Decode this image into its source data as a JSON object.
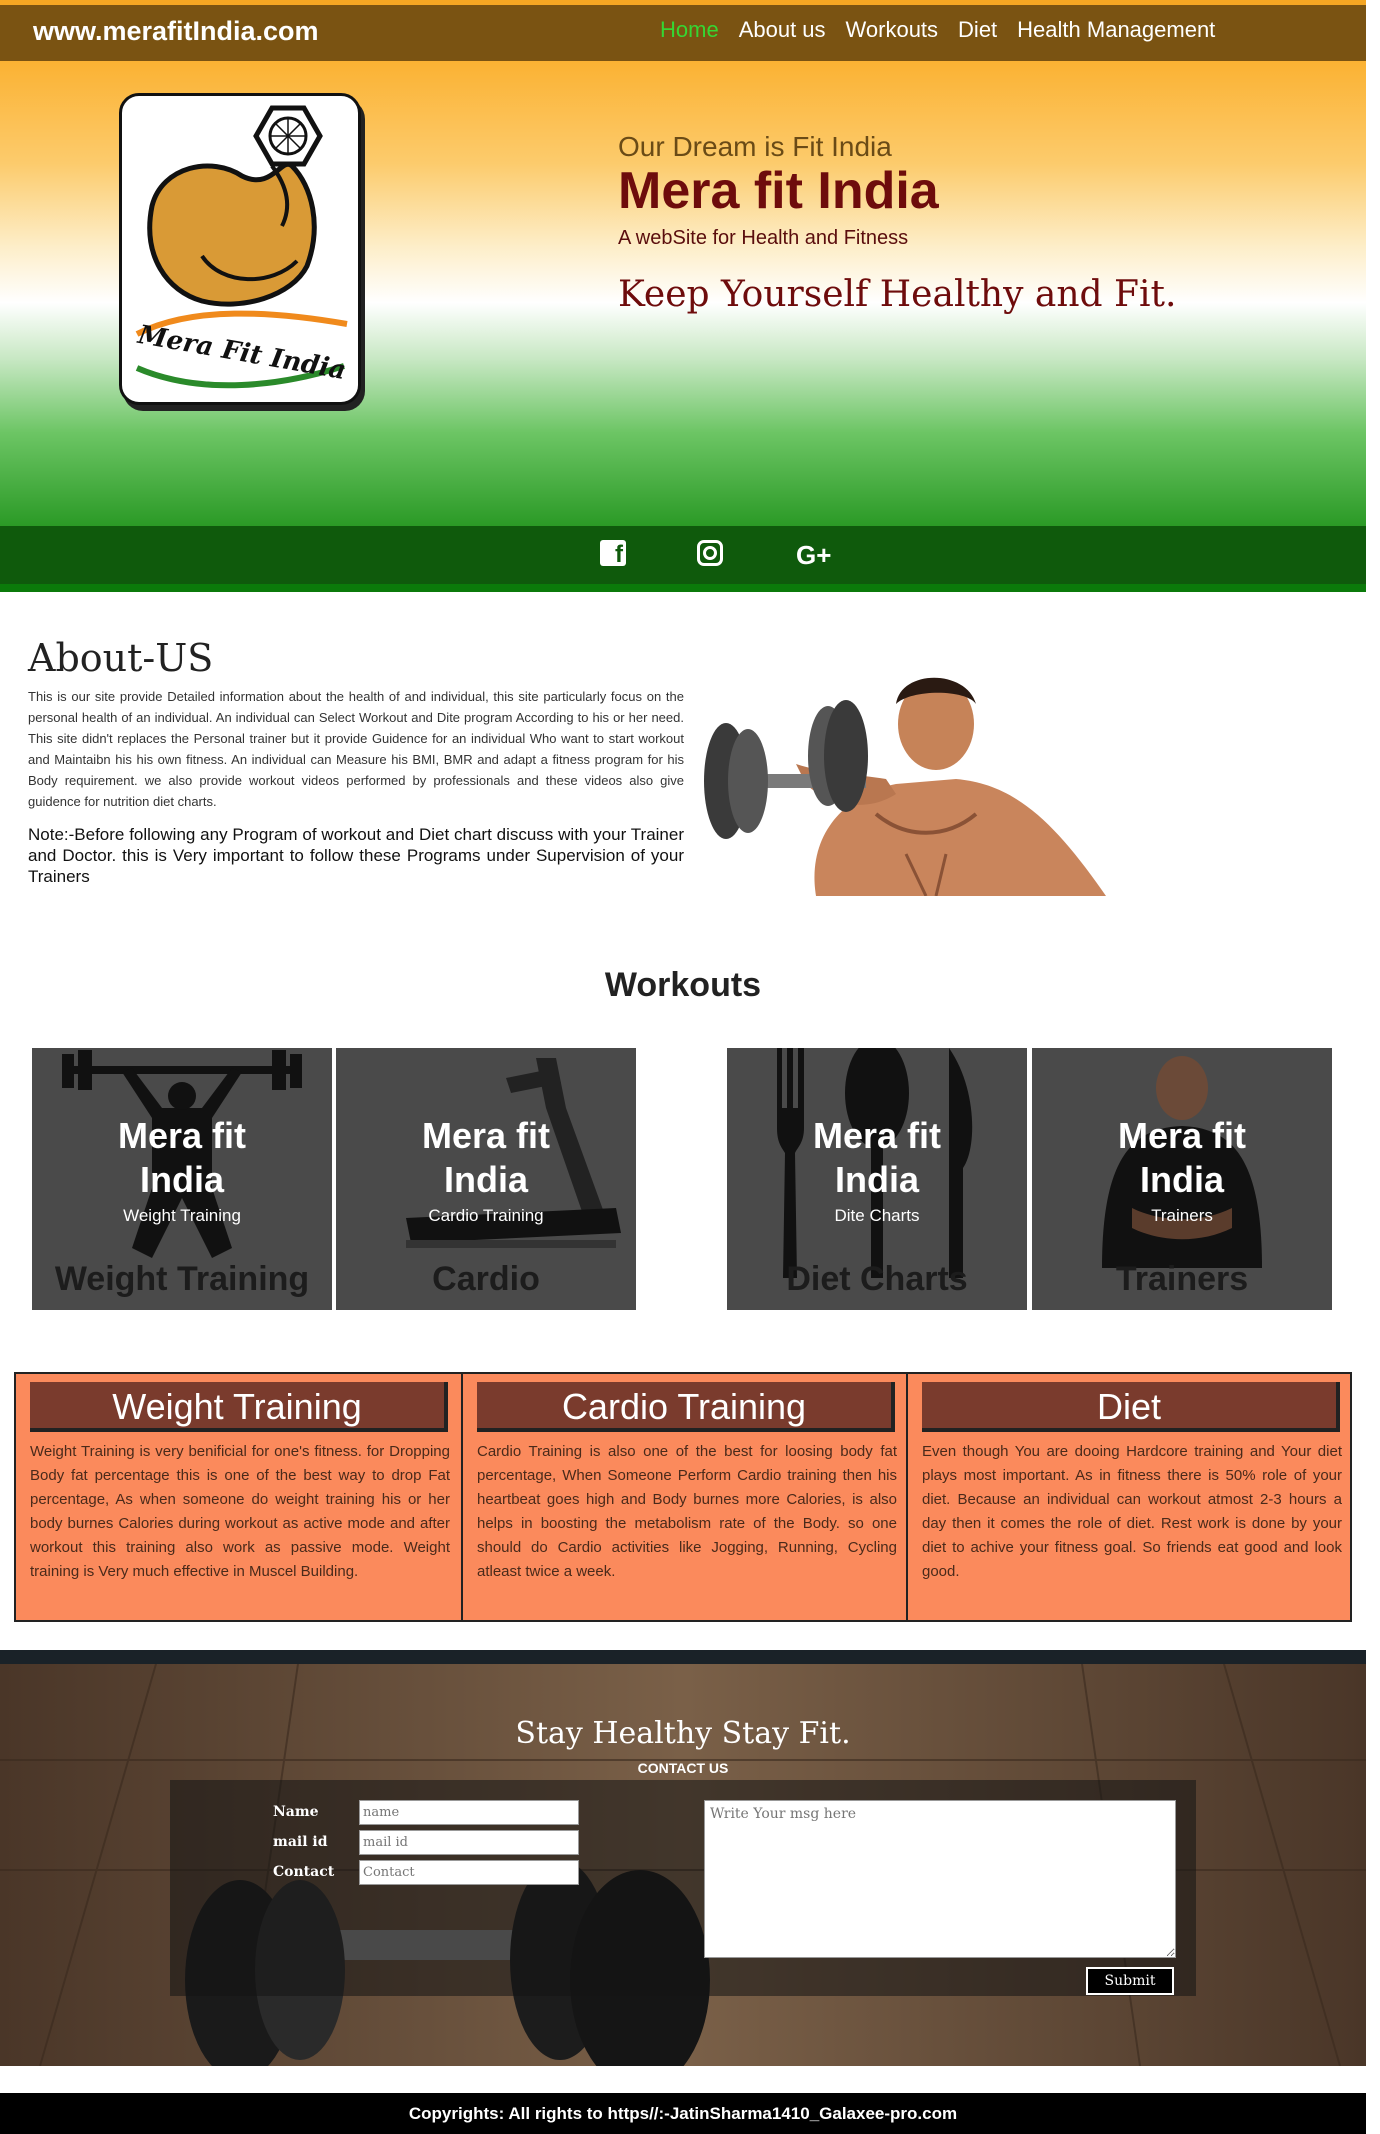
{
  "nav": {
    "brand": "www.merafitIndia.com",
    "items": [
      {
        "label": "Home"
      },
      {
        "label": "About us"
      },
      {
        "label": "Workouts"
      },
      {
        "label": "Diet"
      },
      {
        "label": "Health Management"
      }
    ]
  },
  "hero": {
    "logo_text": "Mera Fit India",
    "tagline": "Our Dream is Fit India",
    "title": "Mera fit India",
    "subtitle": "A webSite for Health and Fitness",
    "slogan": "Keep Yourself Healthy and Fit."
  },
  "social": {
    "facebook": "f",
    "instagram": "◎",
    "google": "G+"
  },
  "about": {
    "title": "About-US",
    "paragraph": "This is our site provide Detailed information about the health of and individual, this site particularly focus on the personal health of an individual. An individual can Select Workout and Dite program According to his or her need. This site didn't replaces the Personal trainer but it provide Guidence for an individual Who want to start workout and Maintaibn his his own fitness. An individual can Measure his BMI, BMR and adapt a fitness program for his Body requirement. we also provide workout videos performed by professionals and these videos also give guidence for nutrition diet charts.",
    "note": "Note:-Before following any Program of workout and Diet chart discuss with your Trainer and Doctor. this is Very important to follow these Programs under Supervision of your Trainers"
  },
  "workouts": {
    "title": "Workouts",
    "tiles": [
      {
        "brand_line1": "Mera fit",
        "brand_line2": "India",
        "sub": "Weight Training",
        "caption": "Weight Training"
      },
      {
        "brand_line1": "Mera fit",
        "brand_line2": "India",
        "sub": "Cardio Training",
        "caption": "Cardio"
      },
      {
        "brand_line1": "Mera fit",
        "brand_line2": "India",
        "sub": "Dite Charts",
        "caption": "Diet Charts"
      },
      {
        "brand_line1": "Mera fit",
        "brand_line2": "India",
        "sub": "Trainers",
        "caption": "Trainers"
      }
    ]
  },
  "panels": [
    {
      "heading": "Weight Training",
      "text": "Weight Training is very benificial for one's fitness. for Dropping Body fat percentage this is one of the best way to drop Fat percentage, As when someone do weight training his or her body burnes Calories during workout as active mode and after workout this training also work as passive mode. Weight training is Very much effective in Muscel Building."
    },
    {
      "heading": "Cardio Training",
      "text": "Cardio Training is also one of the best for loosing body fat percentage, When Someone Perform Cardio training then his heartbeat goes high and Body burnes more Calories, is also helps in boosting the metabolism rate of the Body. so one should do Cardio activities like Jogging, Running, Cycling atleast twice a week."
    },
    {
      "heading": "Diet",
      "text": "Even though You are dooing Hardcore training and Your diet plays most important. As in fitness there is 50% role of your diet. Because an individual can workout atmost 2-3 hours a day then it comes the role of diet. Rest work is done by your diet to achive your fitness goal. So friends eat good and look good."
    }
  ],
  "contact": {
    "title": "Stay Healthy Stay Fit.",
    "subtitle": "CONTACT US",
    "name_label": "Name",
    "name_placeholder": "name",
    "mail_label": "mail id",
    "mail_placeholder": "mail id",
    "contact_label": "Contact",
    "contact_placeholder": "Contact",
    "message_placeholder": "Write Your msg here",
    "submit_label": "Submit"
  },
  "footer": {
    "text": "Copyrights: All rights to https//:-JatinSharma1410_Galaxee-pro.com"
  },
  "colors": {
    "nav_bg": "#7a5312",
    "active_link": "#36d633",
    "title_maroon": "#6e0c0c",
    "social_bar": "#0f5a0c",
    "panel_bg": "#fb8a5c",
    "panel_heading": "#7a3b2d"
  }
}
